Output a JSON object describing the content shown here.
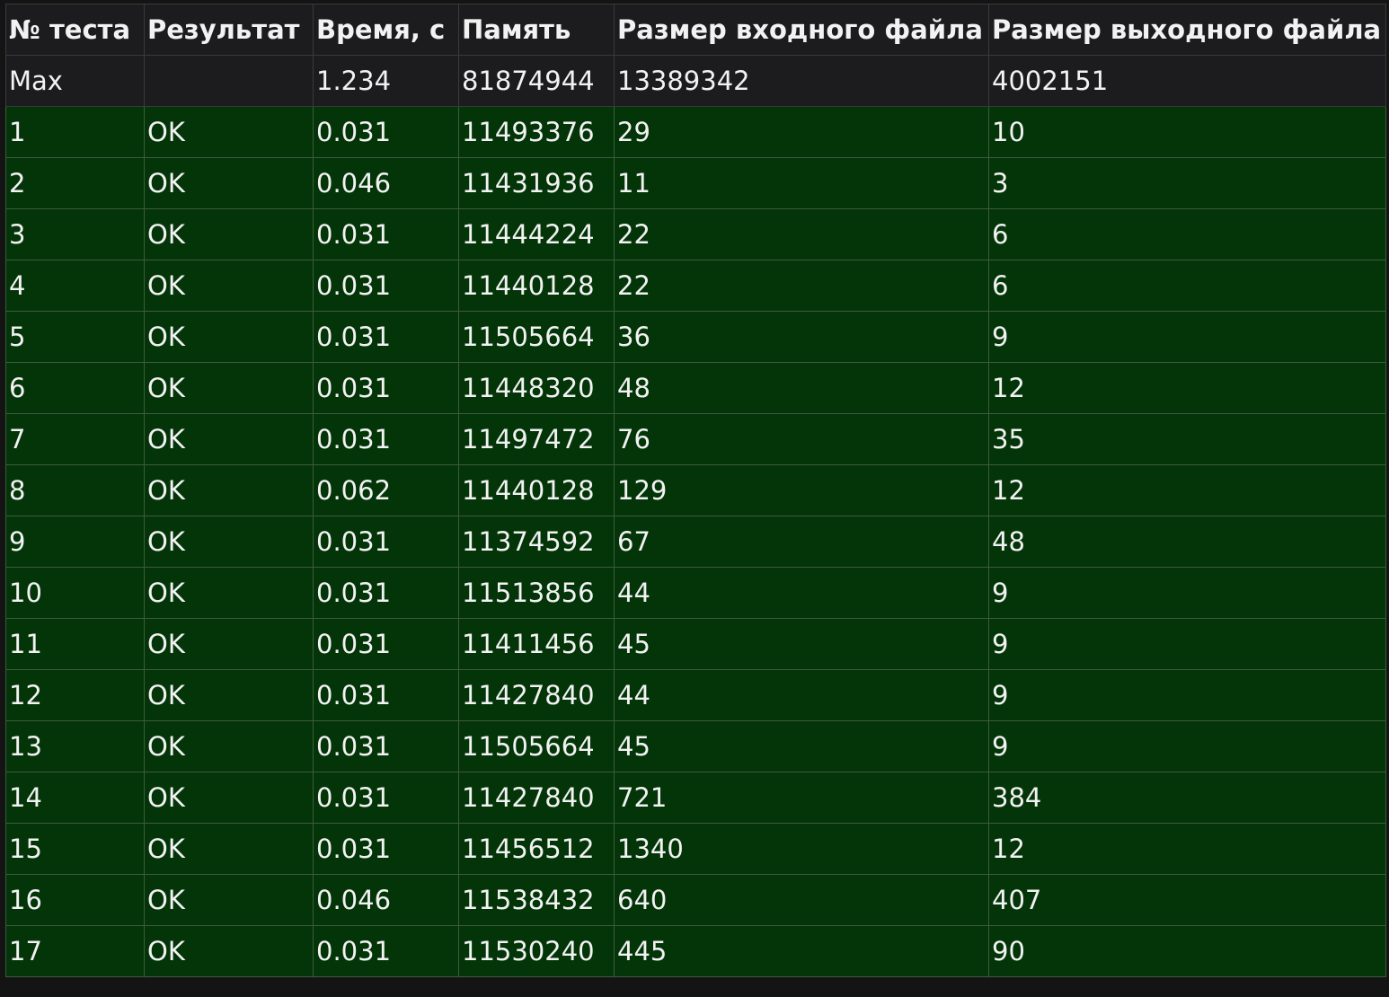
{
  "columns": [
    "№ теста",
    "Результат",
    "Время, с",
    "Память",
    "Размер входного файла",
    "Размер выходного файла"
  ],
  "max_row": [
    "Max",
    "",
    "1.234",
    "81874944",
    "13389342",
    "4002151"
  ],
  "rows": [
    [
      "1",
      "OK",
      "0.031",
      "11493376",
      "29",
      "10"
    ],
    [
      "2",
      "OK",
      "0.046",
      "11431936",
      "11",
      "3"
    ],
    [
      "3",
      "OK",
      "0.031",
      "11444224",
      "22",
      "6"
    ],
    [
      "4",
      "OK",
      "0.031",
      "11440128",
      "22",
      "6"
    ],
    [
      "5",
      "OK",
      "0.031",
      "11505664",
      "36",
      "9"
    ],
    [
      "6",
      "OK",
      "0.031",
      "11448320",
      "48",
      "12"
    ],
    [
      "7",
      "OK",
      "0.031",
      "11497472",
      "76",
      "35"
    ],
    [
      "8",
      "OK",
      "0.062",
      "11440128",
      "129",
      "12"
    ],
    [
      "9",
      "OK",
      "0.031",
      "11374592",
      "67",
      "48"
    ],
    [
      "10",
      "OK",
      "0.031",
      "11513856",
      "44",
      "9"
    ],
    [
      "11",
      "OK",
      "0.031",
      "11411456",
      "45",
      "9"
    ],
    [
      "12",
      "OK",
      "0.031",
      "11427840",
      "44",
      "9"
    ],
    [
      "13",
      "OK",
      "0.031",
      "11505664",
      "45",
      "9"
    ],
    [
      "14",
      "OK",
      "0.031",
      "11427840",
      "721",
      "384"
    ],
    [
      "15",
      "OK",
      "0.031",
      "11456512",
      "1340",
      "12"
    ],
    [
      "16",
      "OK",
      "0.046",
      "11538432",
      "640",
      "407"
    ],
    [
      "17",
      "OK",
      "0.031",
      "11530240",
      "445",
      "90"
    ]
  ],
  "colors": {
    "background": "#141414",
    "header_bg": "#1c1c1e",
    "ok_row_bg": "#033508",
    "text": "#f2f2f2"
  }
}
